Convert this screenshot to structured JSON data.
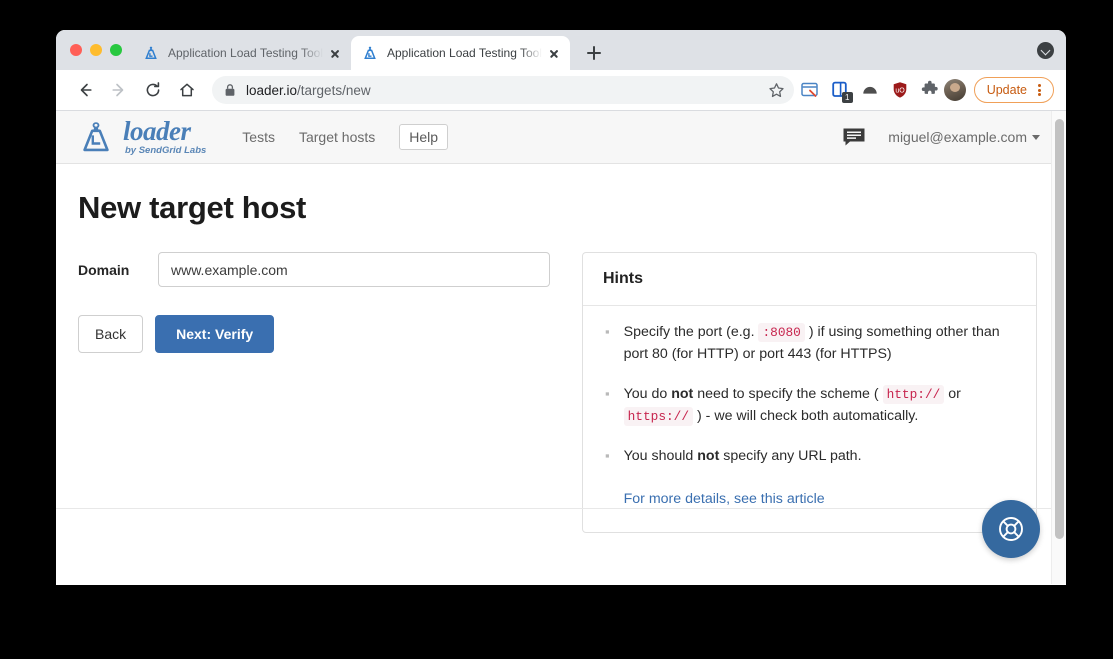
{
  "browser": {
    "tabs": [
      {
        "title": "Application Load Testing Tools",
        "favicon": "loader-favicon",
        "active": false
      },
      {
        "title": "Application Load Testing Tools",
        "favicon": "loader-favicon",
        "active": true
      }
    ],
    "new_tab_label": "+",
    "toolbar": {
      "back_icon": "back-arrow-icon",
      "forward_icon": "forward-arrow-icon",
      "reload_icon": "reload-icon",
      "home_icon": "home-icon",
      "lock_icon": "lock-icon",
      "url_domain": "loader.io",
      "url_path": "/targets/new",
      "bookmark_icon": "star-icon",
      "extensions": [
        {
          "name": "window-inspector-icon"
        },
        {
          "name": "tab-manager-icon",
          "badge": "1"
        },
        {
          "name": "arc-extension-icon"
        },
        {
          "name": "ublock-shield-icon"
        },
        {
          "name": "extensions-puzzle-icon"
        }
      ],
      "avatar_name": "profile-avatar",
      "update_label": "Update",
      "menu_icon": "kebab-menu-icon"
    },
    "window_menu_icon": "circle-chevron-icon"
  },
  "site": {
    "brand": {
      "logo_icon": "loader-weight-logo",
      "name": "loader",
      "tagline": "by SendGrid Labs"
    },
    "nav": [
      {
        "label": "Tests",
        "style": "link"
      },
      {
        "label": "Target hosts",
        "style": "link"
      },
      {
        "label": "Help",
        "style": "button"
      }
    ],
    "header_right": {
      "chat_icon": "chat-bubble-icon",
      "user_email": "miguel@example.com",
      "caret_icon": "caret-down-icon"
    }
  },
  "page": {
    "title": "New target host",
    "form": {
      "domain_label": "Domain",
      "domain_value": "",
      "domain_placeholder": "www.example.com"
    },
    "buttons": {
      "back": "Back",
      "next": "Next: Verify"
    },
    "hints": {
      "heading": "Hints",
      "items": [
        {
          "parts": [
            {
              "t": "text",
              "v": "Specify the port (e.g. "
            },
            {
              "t": "code",
              "v": ":8080"
            },
            {
              "t": "text",
              "v": " ) if using something other than port 80 (for HTTP) or port 443 (for HTTPS)"
            }
          ]
        },
        {
          "parts": [
            {
              "t": "text",
              "v": "You do "
            },
            {
              "t": "bold",
              "v": "not"
            },
            {
              "t": "text",
              "v": " need to specify the scheme ( "
            },
            {
              "t": "code",
              "v": "http://"
            },
            {
              "t": "text",
              "v": " or "
            },
            {
              "t": "code",
              "v": "https://"
            },
            {
              "t": "text",
              "v": " ) - we will check both automatically."
            }
          ]
        },
        {
          "parts": [
            {
              "t": "text",
              "v": "You should "
            },
            {
              "t": "bold",
              "v": "not"
            },
            {
              "t": "text",
              "v": " specify any URL path."
            }
          ]
        }
      ],
      "link": "For more details, see this article"
    },
    "support_fab_icon": "lifebuoy-icon"
  },
  "colors": {
    "brand_blue": "#4a7fb8",
    "primary_button": "#3a6fb0",
    "code_text": "#c7254e",
    "code_bg": "#f9f2f4",
    "link": "#3a6fb0",
    "update_orange": "#c75b10",
    "fab_blue": "#35699f"
  }
}
